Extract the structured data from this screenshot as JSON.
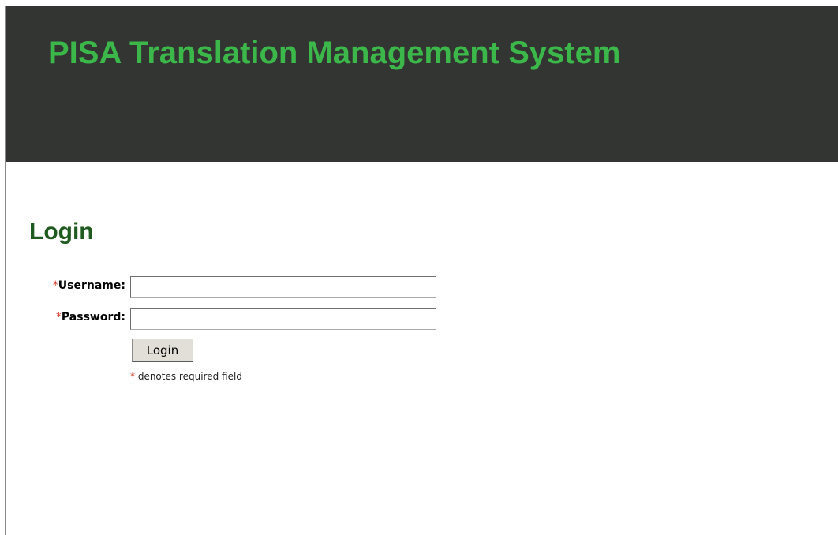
{
  "header": {
    "title": "PISA Translation Management System",
    "background_color": "#323532",
    "title_color": "#3cb84a"
  },
  "login": {
    "heading": "Login",
    "heading_color": "#1f5a1f",
    "required_marker": "*",
    "required_marker_color": "#d63a2a",
    "username_label": "Username:",
    "username_value": "",
    "password_label": "Password:",
    "password_value": "",
    "submit_label": "Login",
    "required_note": "denotes required field"
  }
}
